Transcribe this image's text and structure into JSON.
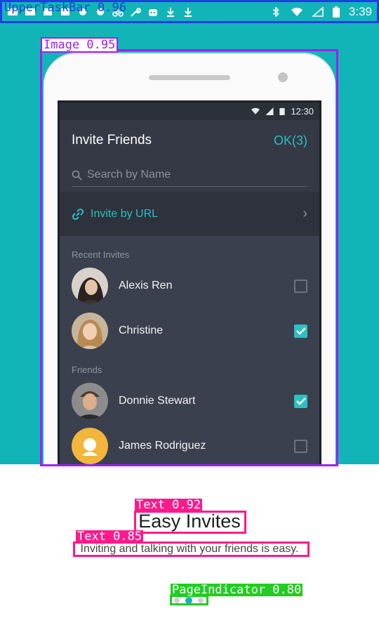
{
  "status_bar": {
    "time": "3:39"
  },
  "mock_screen": {
    "status_time": "12:30",
    "title": "Invite Friends",
    "ok_label": "OK(3)",
    "search_placeholder": "Search by Name",
    "invite_url_label": "Invite by URL",
    "sections": [
      {
        "label": "Recent Invites",
        "contacts": [
          {
            "name": "Alexis Ren",
            "checked": false
          },
          {
            "name": "Christine",
            "checked": true
          }
        ]
      },
      {
        "label": "Friends",
        "contacts": [
          {
            "name": "Donnie Stewart",
            "checked": true
          },
          {
            "name": "James Rodriguez",
            "checked": false
          }
        ]
      }
    ]
  },
  "onboarding": {
    "title": "Easy Invites",
    "subtitle": "Inviting and talking with your friends is easy.",
    "page_count": 3,
    "active_page": 2
  },
  "annotations": [
    {
      "label": "UpperTaskBar 0.96",
      "color": "#1f3fe0"
    },
    {
      "label": "Image 0.95",
      "color": "#a020f0"
    },
    {
      "label": "Text 0.92",
      "color": "#ff1a8c"
    },
    {
      "label": "Text 0.85",
      "color": "#ff1a8c"
    },
    {
      "label": "PageIndicator 0.80",
      "color": "#22cc22"
    }
  ],
  "colors": {
    "teal": "#11b5b8",
    "accent": "#2cc0c3",
    "screen_bg": "#3a404d"
  }
}
